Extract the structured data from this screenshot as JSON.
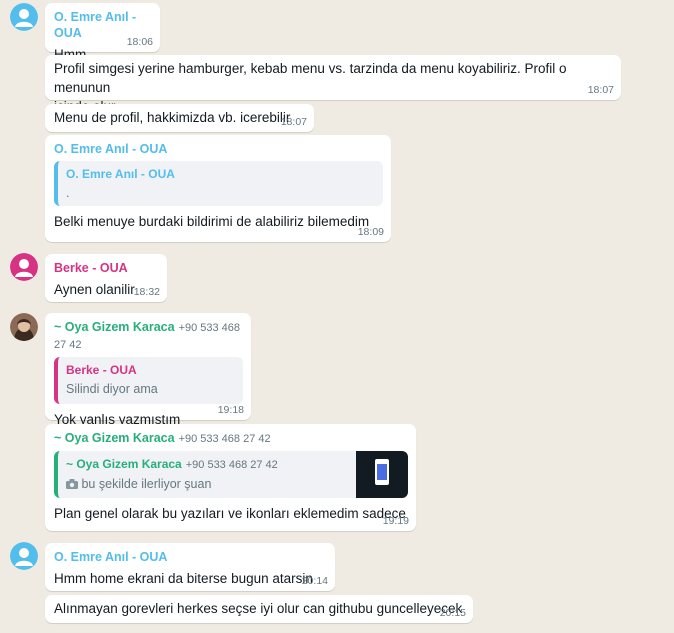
{
  "colors": {
    "background": "#efeae2",
    "bubble": "#ffffff",
    "emre": "#53bdeb",
    "berke": "#d63384",
    "oya": "#25b07a",
    "time": "#667781"
  },
  "messages": [
    {
      "sender": "O. Emre Anıl - OUA",
      "text": "Hmm",
      "time": "18:06"
    },
    {
      "text_line1": "Profil simgesi yerine hamburger, kebab menu vs. tarzinda da menu koyabiliriz. Profil o menunun",
      "text_line2": "icinde olur",
      "time": "18:07"
    },
    {
      "text": "Menu de profil, hakkimizda vb. icerebilir",
      "time": "18:07"
    },
    {
      "sender": "O. Emre Anıl - OUA",
      "quote_sender": "O. Emre Anıl - OUA",
      "quote_text": ".",
      "text": "Belki menuye burdaki bildirimi de alabiliriz bilemedim",
      "time": "18:09"
    },
    {
      "sender": "Berke - OUA",
      "text": "Aynen olanilir",
      "time": "18:32"
    },
    {
      "sender": "~ Oya Gizem Karaca",
      "phone": "+90 533 468 27 42",
      "quote_sender": "Berke - OUA",
      "quote_text": "Silindi diyor ama",
      "text": "Yok yanlış yazmıştım",
      "time": "19:18"
    },
    {
      "sender": "~ Oya Gizem Karaca",
      "phone": "+90 533 468 27 42",
      "quote_sender": "~ Oya Gizem Karaca",
      "quote_phone": "+90 533 468 27 42",
      "quote_text": "bu şekilde ilerliyor şuan",
      "quote_icon": "camera-icon",
      "text": "Plan genel olarak bu yazıları ve ikonları eklemedim sadece",
      "time": "19:19"
    },
    {
      "sender": "O. Emre Anıl - OUA",
      "text": "Hmm home ekrani da biterse bugun atarsin",
      "time": "20:14"
    },
    {
      "text": "Alınmayan gorevleri herkes seçse iyi olur can githubu guncelleyecek",
      "time": "20:15"
    }
  ]
}
